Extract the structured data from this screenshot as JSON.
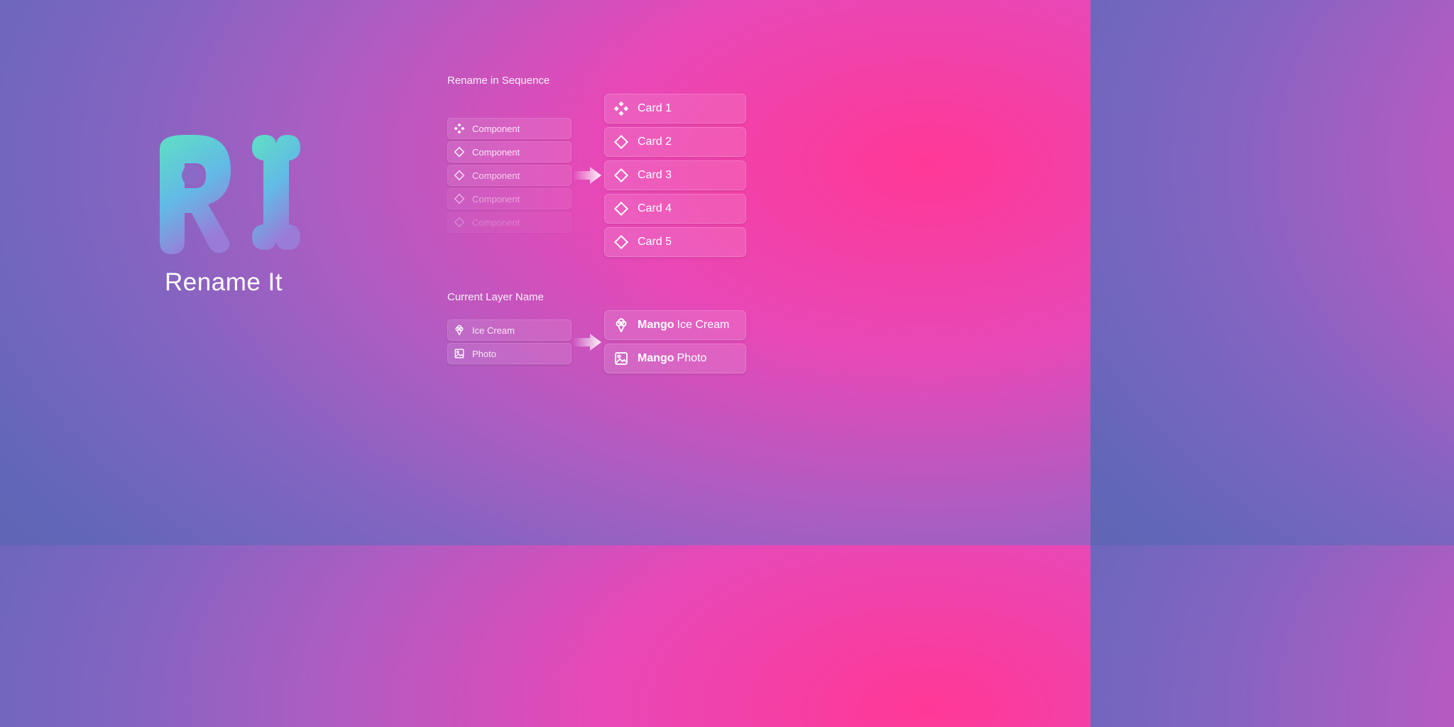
{
  "app": {
    "title": "Rename It"
  },
  "sequence": {
    "title": "Rename in Sequence",
    "left": [
      {
        "icon": "component-filled",
        "label": "Component"
      },
      {
        "icon": "component-outline",
        "label": "Component"
      },
      {
        "icon": "component-outline",
        "label": "Component"
      },
      {
        "icon": "component-outline",
        "label": "Component"
      },
      {
        "icon": "component-outline",
        "label": "Component"
      }
    ],
    "right": [
      {
        "icon": "component-filled",
        "label": "Card 1"
      },
      {
        "icon": "component-outline",
        "label": "Card 2"
      },
      {
        "icon": "component-outline",
        "label": "Card 3"
      },
      {
        "icon": "component-outline",
        "label": "Card 4"
      },
      {
        "icon": "component-outline",
        "label": "Card 5"
      }
    ]
  },
  "currentLayer": {
    "title": "Current Layer Name",
    "prefix": "Mango",
    "left": [
      {
        "icon": "ice-cream",
        "label": "Ice Cream"
      },
      {
        "icon": "image",
        "label": "Photo"
      }
    ],
    "right": [
      {
        "icon": "ice-cream",
        "label": "Ice Cream"
      },
      {
        "icon": "image",
        "label": "Photo"
      }
    ]
  }
}
